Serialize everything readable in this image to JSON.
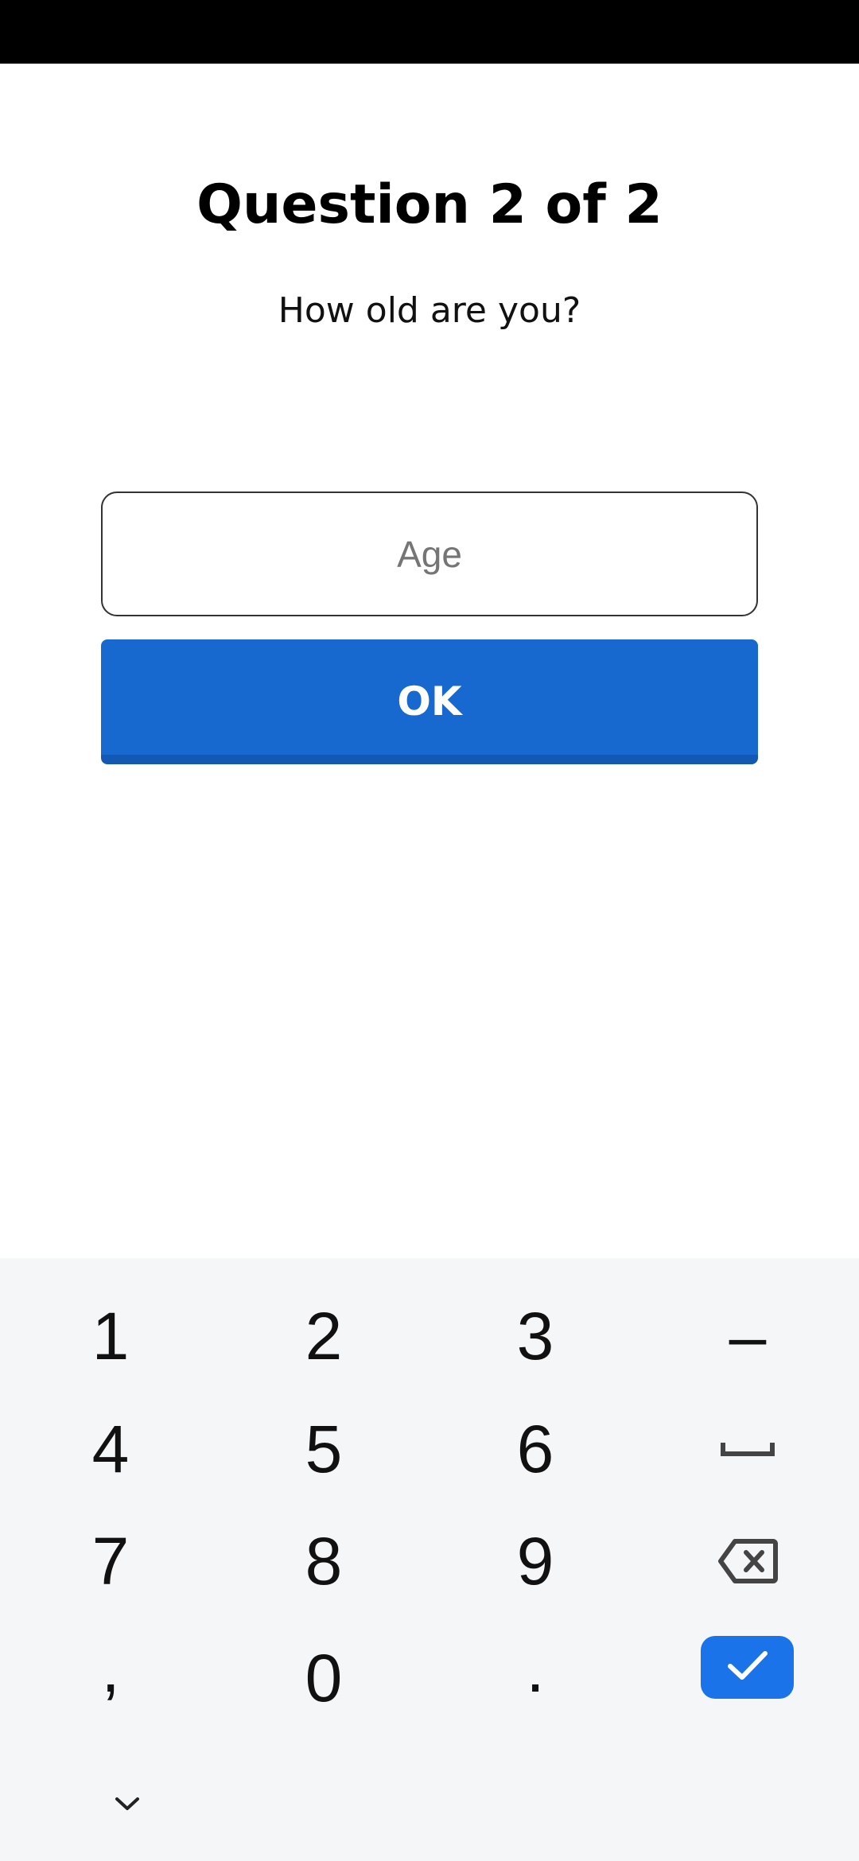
{
  "screen": {
    "title": "Question 2 of 2",
    "question": "How old are you?"
  },
  "age_field": {
    "placeholder": "Age",
    "value": ""
  },
  "ok_button": {
    "label": "OK"
  },
  "keyboard": {
    "keys": {
      "k1": "1",
      "k2": "2",
      "k3": "3",
      "k4": "4",
      "k5": "5",
      "k6": "6",
      "k7": "7",
      "k8": "8",
      "k9": "9",
      "k0": "0",
      "comma": ",",
      "period": ".",
      "minus": "–"
    },
    "icons": {
      "space": "space-icon",
      "backspace": "backspace-icon",
      "enter": "checkmark-icon",
      "collapse": "chevron-down-icon"
    },
    "accent_color": "#1a73e8"
  },
  "colors": {
    "primary_button": "#1769d0",
    "status_bar": "#000000",
    "keyboard_background": "#f5f6f8"
  }
}
